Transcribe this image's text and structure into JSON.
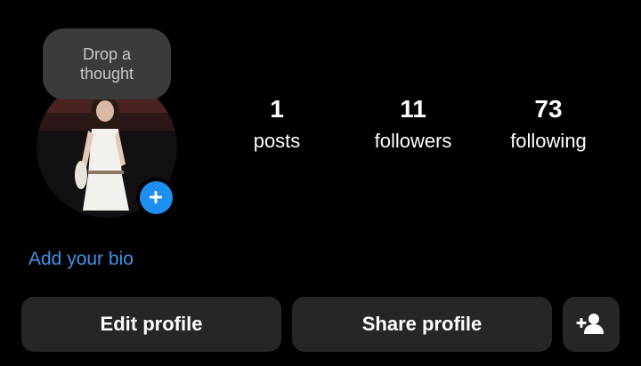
{
  "note": {
    "text": "Drop a thought"
  },
  "stats": [
    {
      "value": "1",
      "label": "posts"
    },
    {
      "value": "11",
      "label": "followers"
    },
    {
      "value": "73",
      "label": "following"
    }
  ],
  "bio": {
    "link_text": "Add your bio"
  },
  "actions": {
    "edit_label": "Edit profile",
    "share_label": "Share profile",
    "add_user_icon": "person-add-icon"
  },
  "colors": {
    "background": "#000000",
    "accent": "#1f8ef1",
    "button": "#262626",
    "link": "#3d93e8"
  }
}
